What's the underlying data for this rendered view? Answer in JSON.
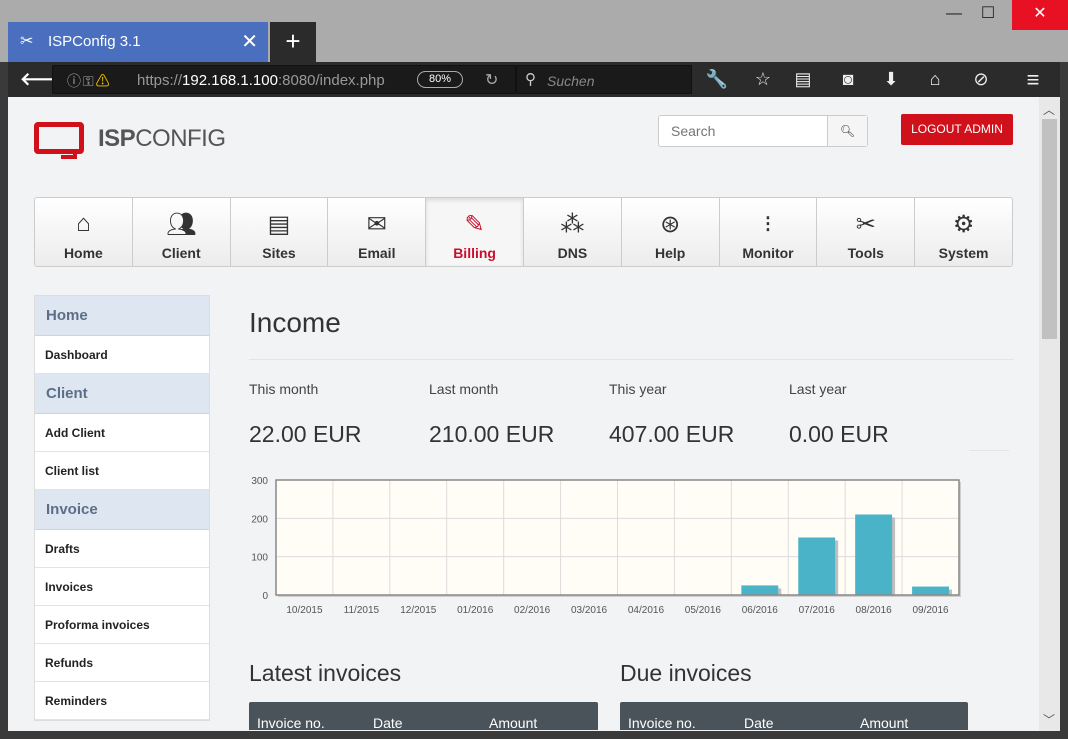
{
  "browser": {
    "tab_title": "ISPConfig 3.1",
    "url_prefix": "https://",
    "url_host": "192.168.1.100",
    "url_rest": ":8080/index.php",
    "zoom": "80%",
    "search_placeholder": "Suchen"
  },
  "header": {
    "logo_bold": "ISP",
    "logo_light": "CONFIG",
    "search_placeholder": "Search",
    "logout_label": "LOGOUT ADMIN"
  },
  "mainnav": [
    {
      "label": "Home",
      "icon": "home-icon",
      "active": false
    },
    {
      "label": "Client",
      "icon": "client-icon",
      "active": false
    },
    {
      "label": "Sites",
      "icon": "sites-icon",
      "active": false
    },
    {
      "label": "Email",
      "icon": "email-icon",
      "active": false
    },
    {
      "label": "Billing",
      "icon": "billing-icon",
      "active": true
    },
    {
      "label": "DNS",
      "icon": "dns-icon",
      "active": false
    },
    {
      "label": "Help",
      "icon": "help-icon",
      "active": false
    },
    {
      "label": "Monitor",
      "icon": "monitor-icon",
      "active": false
    },
    {
      "label": "Tools",
      "icon": "tools-icon",
      "active": false
    },
    {
      "label": "System",
      "icon": "system-icon",
      "active": false
    }
  ],
  "sidebar": [
    {
      "type": "section",
      "label": "Home"
    },
    {
      "type": "link",
      "label": "Dashboard"
    },
    {
      "type": "section",
      "label": "Client"
    },
    {
      "type": "link",
      "label": "Add Client"
    },
    {
      "type": "link",
      "label": "Client list"
    },
    {
      "type": "section",
      "label": "Invoice"
    },
    {
      "type": "link",
      "label": "Drafts"
    },
    {
      "type": "link",
      "label": "Invoices"
    },
    {
      "type": "link",
      "label": "Proforma invoices"
    },
    {
      "type": "link",
      "label": "Refunds"
    },
    {
      "type": "link",
      "label": "Reminders"
    }
  ],
  "income": {
    "title": "Income",
    "stats": [
      {
        "label": "This month",
        "value": "22.00 EUR"
      },
      {
        "label": "Last month",
        "value": "210.00 EUR"
      },
      {
        "label": "This year",
        "value": "407.00 EUR"
      },
      {
        "label": "Last year",
        "value": "0.00 EUR"
      }
    ]
  },
  "chart_data": {
    "type": "bar",
    "categories": [
      "10/2015",
      "11/2015",
      "12/2015",
      "01/2016",
      "02/2016",
      "03/2016",
      "04/2016",
      "05/2016",
      "06/2016",
      "07/2016",
      "08/2016",
      "09/2016"
    ],
    "values": [
      0,
      0,
      0,
      0,
      0,
      0,
      0,
      0,
      25,
      150,
      210,
      22
    ],
    "yticks": [
      0,
      100,
      200,
      300
    ],
    "ylim": [
      0,
      300
    ],
    "bar_color": "#4ab3c7",
    "plot_bg": "#fffdf5",
    "grid": true
  },
  "latest_invoices": {
    "title": "Latest invoices",
    "columns": [
      "Invoice no.",
      "Date",
      "Amount"
    ]
  },
  "due_invoices": {
    "title": "Due invoices",
    "columns": [
      "Invoice no.",
      "Date",
      "Amount"
    ]
  }
}
